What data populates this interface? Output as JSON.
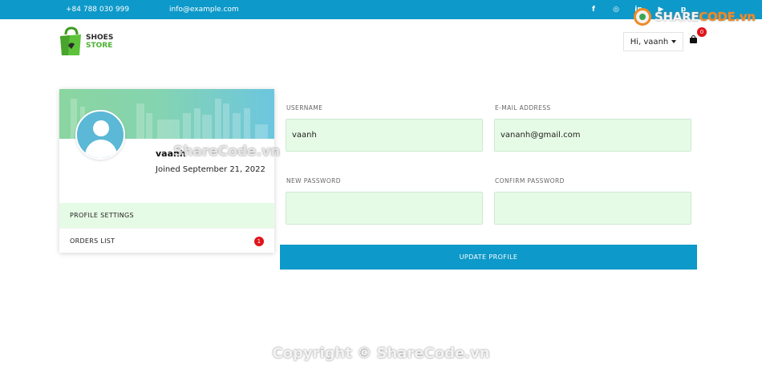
{
  "topbar": {
    "phone": "+84 788 030 999",
    "email": "info@example.com",
    "socials": [
      {
        "icon": "facebook-icon",
        "glyph": "f"
      },
      {
        "icon": "instagram-icon",
        "glyph": "◎"
      },
      {
        "icon": "linkedin-icon",
        "glyph": "in"
      },
      {
        "icon": "youtube-icon",
        "glyph": "▶"
      },
      {
        "icon": "pinterest-icon",
        "glyph": "p"
      }
    ]
  },
  "watermark": {
    "brand_main": "SHARE",
    "brand_accent": "CODE.vn",
    "middle": "ShareCode.vn",
    "copyright": "Copyright © ShareCode.vn"
  },
  "header": {
    "logo_line1": "SHOES",
    "logo_line2": "STORE",
    "greeting": "Hi, vaanh",
    "cart_count": "0"
  },
  "profile": {
    "username": "vaanh",
    "joined": "Joined September 21, 2022",
    "menu": {
      "settings": "PROFILE SETTINGS",
      "orders": "ORDERS LIST",
      "orders_badge": "1"
    }
  },
  "form": {
    "username_label": "USERNAME",
    "username_value": "vaanh",
    "email_label": "E-MAIL ADDRESS",
    "email_value": "vananh@gmail.com",
    "new_password_label": "NEW PASSWORD",
    "new_password_value": "",
    "confirm_password_label": "CONFIRM PASSWORD",
    "confirm_password_value": "",
    "submit": "UPDATE PROFILE"
  },
  "colors": {
    "accent": "#0d99c9",
    "input_bg": "#e6fbe6",
    "badge": "#e0141b",
    "brand_green": "#4cb231"
  }
}
